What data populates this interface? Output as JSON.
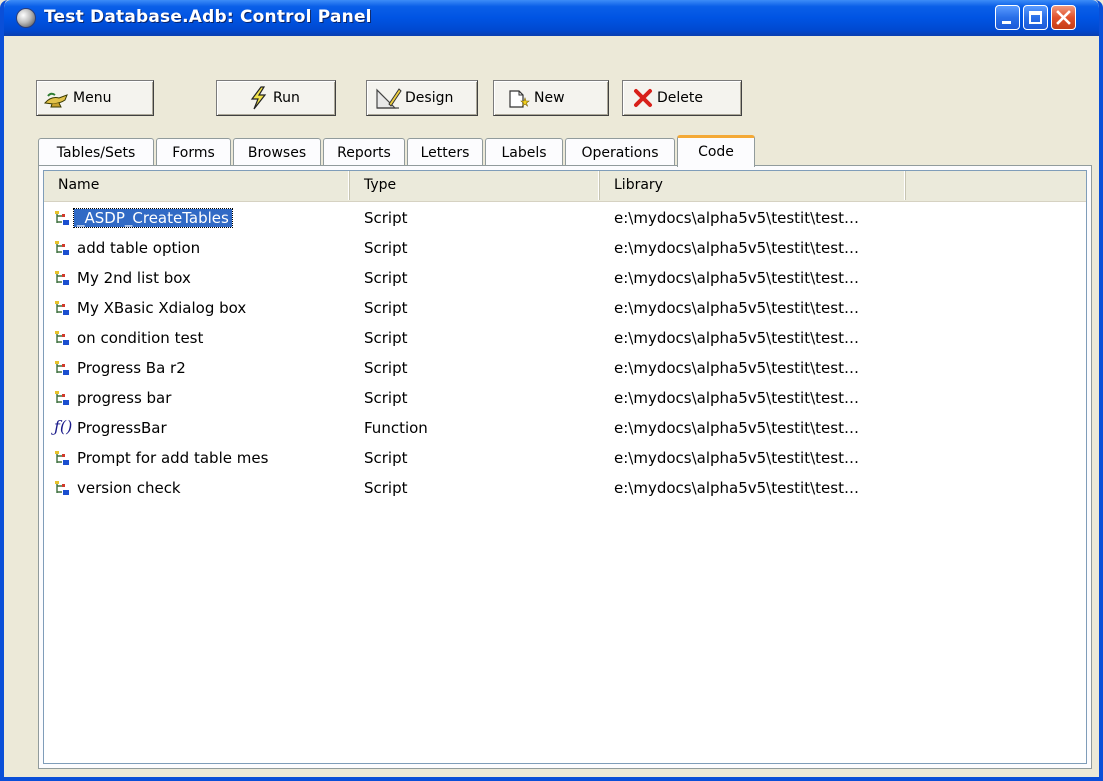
{
  "window": {
    "title": "Test Database.Adb: Control Panel"
  },
  "toolbar": {
    "menu_label": "Menu",
    "run_label": "Run",
    "design_label": "Design",
    "new_label": "New",
    "delete_label": "Delete"
  },
  "tabs": [
    {
      "label": "Tables/Sets"
    },
    {
      "label": "Forms"
    },
    {
      "label": "Browses"
    },
    {
      "label": "Reports"
    },
    {
      "label": "Letters"
    },
    {
      "label": "Labels"
    },
    {
      "label": "Operations"
    },
    {
      "label": "Code",
      "active": true
    }
  ],
  "list": {
    "columns": [
      "Name",
      "Type",
      "Library"
    ],
    "rows": [
      {
        "name": "_ASDP_CreateTables",
        "type": "Script",
        "library": "e:\\mydocs\\alpha5v5\\testit\\test…",
        "icon": "script-icon",
        "selected": true
      },
      {
        "name": "add table option",
        "type": "Script",
        "library": "e:\\mydocs\\alpha5v5\\testit\\test…",
        "icon": "script-icon"
      },
      {
        "name": "My 2nd list box",
        "type": "Script",
        "library": "e:\\mydocs\\alpha5v5\\testit\\test…",
        "icon": "script-icon"
      },
      {
        "name": "My XBasic Xdialog box",
        "type": "Script",
        "library": "e:\\mydocs\\alpha5v5\\testit\\test…",
        "icon": "script-icon"
      },
      {
        "name": "on condition test",
        "type": "Script",
        "library": "e:\\mydocs\\alpha5v5\\testit\\test…",
        "icon": "script-icon"
      },
      {
        "name": "Progress Ba r2",
        "type": "Script",
        "library": "e:\\mydocs\\alpha5v5\\testit\\test…",
        "icon": "script-icon"
      },
      {
        "name": "progress bar",
        "type": "Script",
        "library": "e:\\mydocs\\alpha5v5\\testit\\test…",
        "icon": "script-icon"
      },
      {
        "name": "ProgressBar",
        "type": "Function",
        "library": "e:\\mydocs\\alpha5v5\\testit\\test…",
        "icon": "function-icon"
      },
      {
        "name": "Prompt for add table mes",
        "type": "Script",
        "library": "e:\\mydocs\\alpha5v5\\testit\\test…",
        "icon": "script-icon"
      },
      {
        "name": "version check",
        "type": "Script",
        "library": "e:\\mydocs\\alpha5v5\\testit\\test…",
        "icon": "script-icon"
      }
    ]
  },
  "colors": {
    "titlebar": "#0054e3",
    "selection": "#316ac5",
    "active_tab_accent": "#f4a936",
    "delete_icon": "#d8201a"
  }
}
